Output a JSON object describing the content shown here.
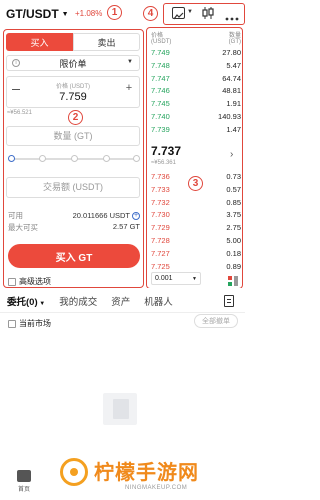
{
  "header": {
    "pair": "GT/USDT",
    "dropdown_arrow": "▼",
    "change": "+1.08%"
  },
  "annotations": [
    "1",
    "2",
    "3",
    "4"
  ],
  "order_form": {
    "tab_buy": "买入",
    "tab_sell": "卖出",
    "order_type": "限价单",
    "price_label": "价格 (USDT)",
    "price_value": "7.759",
    "price_cny": "≈¥56.521",
    "amount_placeholder": "数量 (GT)",
    "total_placeholder": "交易额 (USDT)",
    "available_label": "可用",
    "available_value": "20.011666 USDT",
    "max_buy_label": "最大可买",
    "max_buy_value": "2.57 GT",
    "buy_button": "买入 GT",
    "advanced_label": "高级选项"
  },
  "order_book": {
    "price_header": "价格\n(USDT)",
    "qty_header": "数量\n(GT)",
    "asks_top": [
      {
        "price": "7.749",
        "qty": "27.80"
      },
      {
        "price": "7.748",
        "qty": "5.47"
      },
      {
        "price": "7.747",
        "qty": "64.74"
      },
      {
        "price": "7.746",
        "qty": "48.81"
      },
      {
        "price": "7.745",
        "qty": "1.91"
      },
      {
        "price": "7.740",
        "qty": "140.93"
      },
      {
        "price": "7.739",
        "qty": "1.47"
      }
    ],
    "mid_price": "7.737",
    "mid_cny": "≈¥56.361",
    "bids": [
      {
        "price": "7.736",
        "qty": "0.73"
      },
      {
        "price": "7.733",
        "qty": "0.57"
      },
      {
        "price": "7.732",
        "qty": "0.85"
      },
      {
        "price": "7.730",
        "qty": "3.75"
      },
      {
        "price": "7.729",
        "qty": "2.75"
      },
      {
        "price": "7.728",
        "qty": "5.00"
      },
      {
        "price": "7.727",
        "qty": "0.18"
      },
      {
        "price": "7.725",
        "qty": "0.89"
      }
    ],
    "precision": "0.001"
  },
  "bottom": {
    "tabs": [
      "委托(0)",
      "我的成交",
      "资产",
      "机器人"
    ],
    "current_market": "当前市场",
    "cancel_all": "全部撤单",
    "home": "首页"
  },
  "watermark": {
    "text": "柠檬手游网",
    "url": "NINGMAKEUP.COM"
  },
  "colors": {
    "accent_red": "#ec4a3c",
    "green": "#25a45e",
    "annotation": "#e0473c"
  }
}
